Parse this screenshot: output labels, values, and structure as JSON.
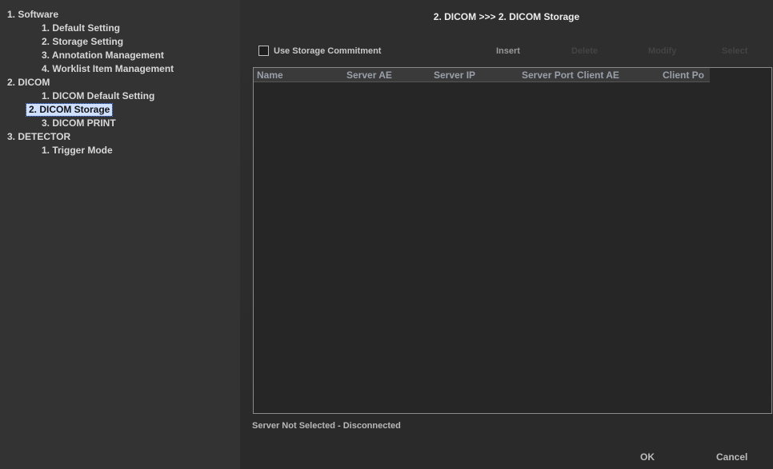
{
  "tree": [
    {
      "label": "1. Software",
      "level": 0
    },
    {
      "label": "1. Default Setting",
      "level": 1
    },
    {
      "label": "2. Storage Setting",
      "level": 1
    },
    {
      "label": "3. Annotation Management",
      "level": 1
    },
    {
      "label": "4. Worklist Item Management",
      "level": 1
    },
    {
      "label": "2. DICOM",
      "level": 0
    },
    {
      "label": "1. DICOM Default Setting",
      "level": 1
    },
    {
      "label": "2. DICOM Storage",
      "level": 1,
      "selected": true
    },
    {
      "label": "3. DICOM PRINT",
      "level": 1
    },
    {
      "label": "3. DETECTOR",
      "level": 0
    },
    {
      "label": "1. Trigger Mode",
      "level": 1
    }
  ],
  "page_title": "2. DICOM >>> 2. DICOM Storage",
  "storage_commitment": {
    "label": "Use Storage Commitment",
    "checked": false
  },
  "buttons": {
    "insert": "Insert",
    "delete": "Delete",
    "modify": "Modify",
    "select": "Select"
  },
  "table": {
    "columns": [
      "Name",
      "Server AE",
      "Server IP",
      "Server Port",
      "Client AE",
      "Client Po"
    ],
    "rows": []
  },
  "status_text": "Server Not Selected - Disconnected",
  "dialog": {
    "ok": "OK",
    "cancel": "Cancel"
  },
  "colors": {
    "selection_bg": "#cfe0ff",
    "panel_bg": "#2a2a2a"
  }
}
